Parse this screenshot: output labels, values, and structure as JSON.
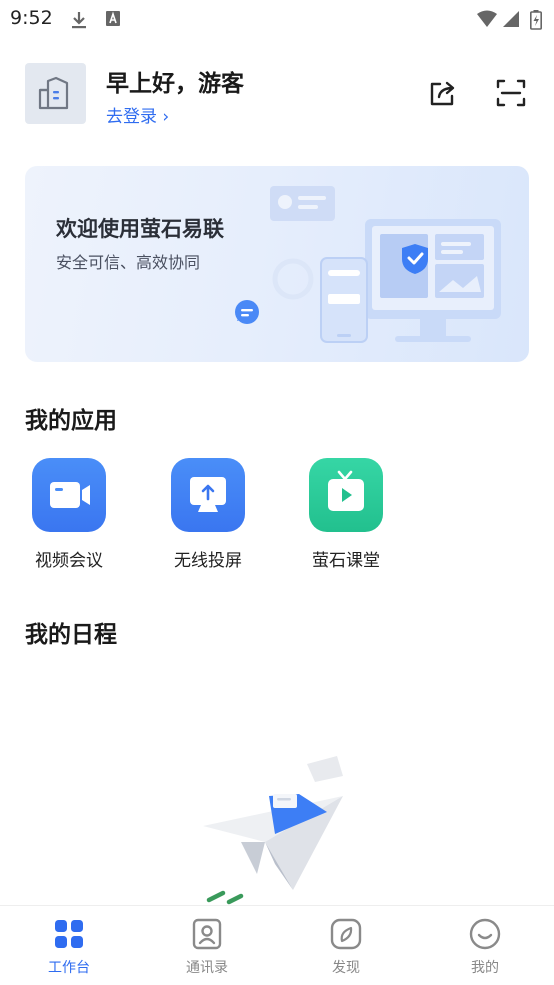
{
  "status_bar": {
    "time": "9:52"
  },
  "header": {
    "greeting": "早上好，游客",
    "login_link": "去登录 ›"
  },
  "banner": {
    "title": "欢迎使用萤石易联",
    "subtitle": "安全可信、高效协同"
  },
  "apps_section": {
    "title": "我的应用",
    "apps": [
      {
        "label": "视频会议",
        "icon": "video-camera-icon",
        "color": "#3d7ef5"
      },
      {
        "label": "无线投屏",
        "icon": "screen-cast-icon",
        "color": "#3d7ef5"
      },
      {
        "label": "萤石课堂",
        "icon": "tv-play-icon",
        "color": "#2dcb9a"
      }
    ]
  },
  "schedule_section": {
    "title": "我的日程"
  },
  "tabbar": {
    "active_color": "#2f6cf0",
    "tabs": [
      {
        "label": "工作台",
        "icon": "grid-icon",
        "active": true
      },
      {
        "label": "通讯录",
        "icon": "contacts-icon",
        "active": false
      },
      {
        "label": "发现",
        "icon": "compass-icon",
        "active": false
      },
      {
        "label": "我的",
        "icon": "smile-icon",
        "active": false
      }
    ]
  }
}
